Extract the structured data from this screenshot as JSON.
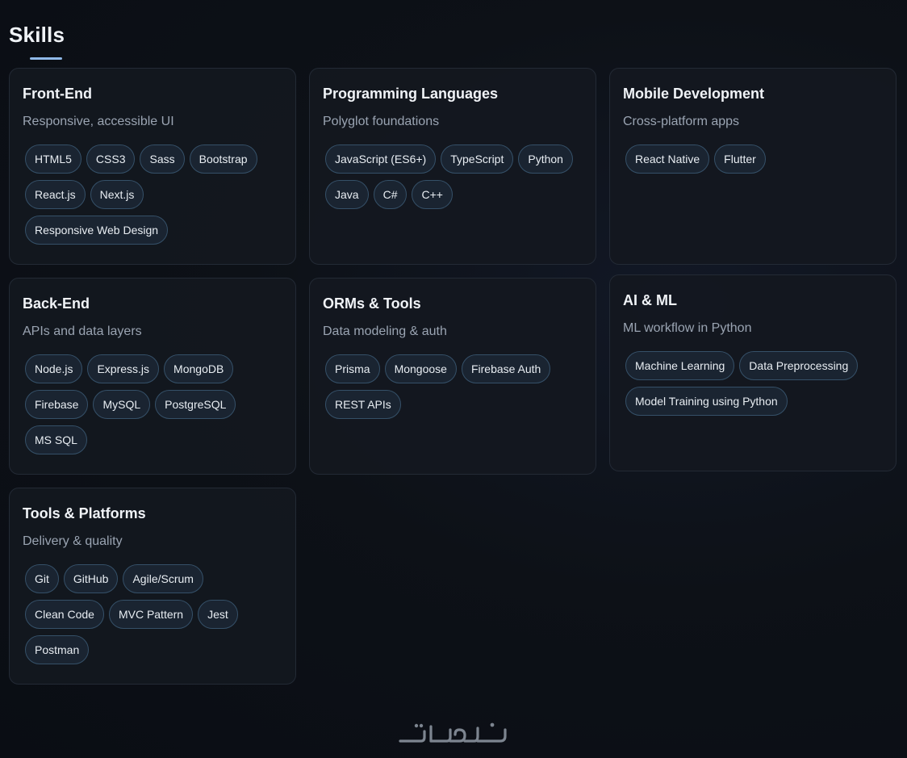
{
  "section": {
    "title": "Skills"
  },
  "cards": [
    {
      "title": "Front-End",
      "subtitle": "Responsive, accessible UI",
      "chips": [
        "HTML5",
        "CSS3",
        "Sass",
        "Bootstrap",
        "React.js",
        "Next.js",
        "Responsive Web Design"
      ]
    },
    {
      "title": "Programming Languages",
      "subtitle": "Polyglot foundations",
      "chips": [
        "JavaScript (ES6+)",
        "TypeScript",
        "Python",
        "Java",
        "C#",
        "C++"
      ]
    },
    {
      "title": "Mobile Development",
      "subtitle": "Cross-platform apps",
      "chips": [
        "React Native",
        "Flutter"
      ]
    },
    {
      "title": "Back-End",
      "subtitle": "APIs and data layers",
      "chips": [
        "Node.js",
        "Express.js",
        "MongoDB",
        "Firebase",
        "MySQL",
        "PostgreSQL",
        "MS SQL"
      ]
    },
    {
      "title": "ORMs & Tools",
      "subtitle": "Data modeling & auth",
      "chips": [
        "Prisma",
        "Mongoose",
        "Firebase Auth",
        "REST APIs"
      ]
    },
    {
      "title": "AI & ML",
      "subtitle": "ML workflow in Python",
      "chips": [
        "Machine Learning",
        "Data Preprocessing",
        "Model Training using Python"
      ]
    },
    {
      "title": "Tools & Platforms",
      "subtitle": "Delivery & quality",
      "chips": [
        "Git",
        "GitHub",
        "Agile/Scrum",
        "Clean Code",
        "MVC Pattern",
        "Jest",
        "Postman"
      ]
    }
  ],
  "watermark": {
    "text": "خمسات",
    "icon": "khamsat-logo"
  },
  "colors": {
    "background": "#0d1117",
    "card_background": "#141820",
    "chip_border": "#355068",
    "accent": "#8fb8e8"
  }
}
